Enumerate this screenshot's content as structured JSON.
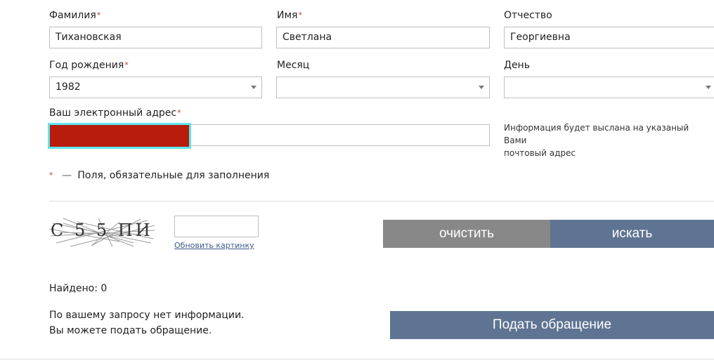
{
  "form": {
    "surname": {
      "label": "Фамилия",
      "required_mark": "*",
      "value": "Тихановская"
    },
    "name": {
      "label": "Имя",
      "required_mark": "*",
      "value": "Светлана"
    },
    "patronymic": {
      "label": "Отчество",
      "value": "Георгиевна"
    },
    "birth_year": {
      "label": "Год рождения",
      "required_mark": "*",
      "value": "1982"
    },
    "month": {
      "label": "Месяц",
      "value": ""
    },
    "day": {
      "label": "День",
      "value": ""
    },
    "email": {
      "label": "Ваш электронный адрес",
      "required_mark": "*",
      "value": "",
      "highlight_color": "#b71c0c",
      "focus_color": "#5ee6ee"
    },
    "email_hint_line1": "Информация будет выслана на указаный Вами",
    "email_hint_line2": "почтовый адрес",
    "required_note_mark": "*",
    "required_note_dash": "—",
    "required_note_text": "Поля, обязательные для заполнения"
  },
  "captcha": {
    "image_text": "C 5 5 ПИ",
    "input_value": "",
    "refresh_link": "Обновить картинку"
  },
  "buttons": {
    "clear": "очистить",
    "search": "искать",
    "appeal": "Подать обращение"
  },
  "results": {
    "found": "Найдено: 0",
    "message_line1": "По вашему запросу нет информации.",
    "message_line2": "Вы можете подать обращение."
  },
  "colors": {
    "accent": "#5f7492",
    "clear_button": "#888888",
    "required": "#c0392b"
  }
}
